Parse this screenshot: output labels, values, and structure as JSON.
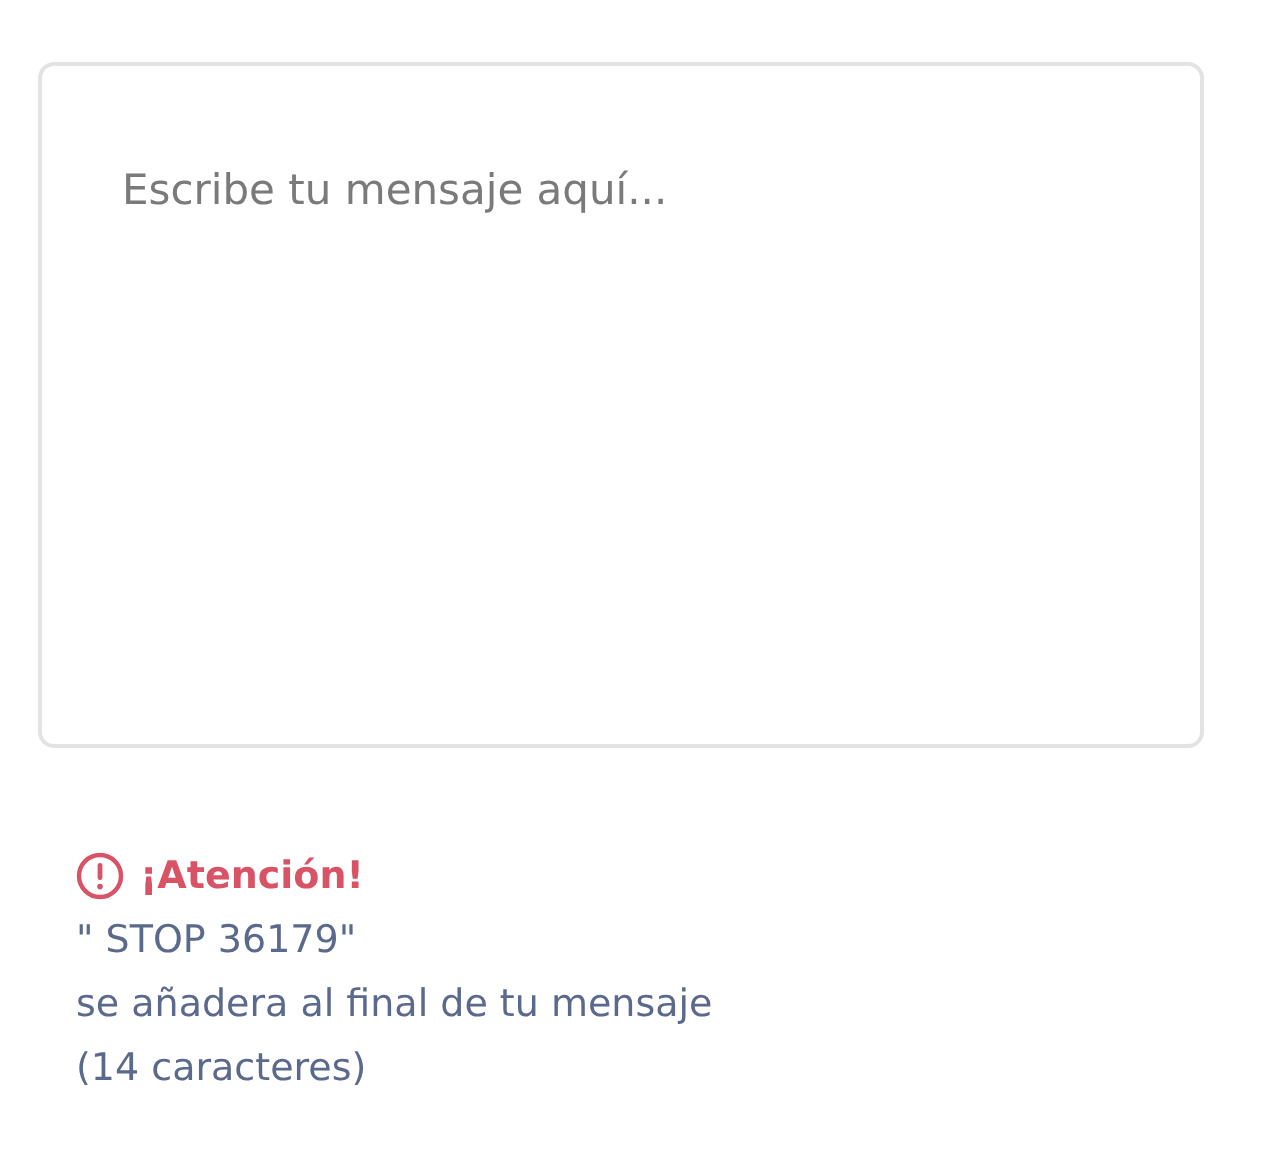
{
  "message": {
    "placeholder": "Escribe tu mensaje aquí..."
  },
  "warning": {
    "title": "¡Atención!",
    "lines": [
      "\" STOP 36179\"",
      "se añadera al final de tu mensaje",
      "(14 caracteres)"
    ]
  }
}
